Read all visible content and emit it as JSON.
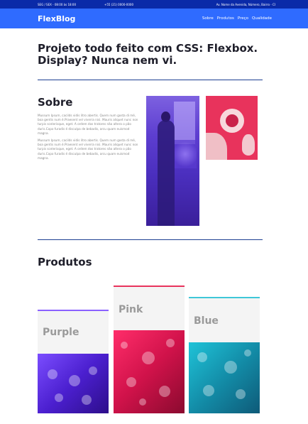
{
  "topbar": {
    "schedule": "SEG / SEX - 08:00 às 18:00",
    "phone": "+55 (21) 0000-0000",
    "address": "Av. Nome da Avenida, Número, Bairro - CI"
  },
  "header": {
    "logo": "FlexBlog",
    "nav": [
      "Sobre",
      "Produtos",
      "Preço",
      "Qualidade"
    ]
  },
  "intro": {
    "title_line1": "Projeto todo feito com CSS: Flexbox.",
    "title_line2": "Display? Nunca nem vi."
  },
  "sobre": {
    "title": "Sobre",
    "paragraphs": [
      "Mussum Ipsum, cacilds vidis litro abertis. Quem num gosta di mé, boa gentis num é.Praesent vel viverra nisi. Mauris aliquet nunc non turpis scelerisque, eget. A ordem dos tratores não altera o pão duris.Copo furadis é disculpa de bebadis, arcu quam euismod magna.",
      "Mussum Ipsum, cacilds vidis litro abertis. Quem num gosta di mé, boa gentis num é.Praesent vel viverra nisi. Mauris aliquet nunc non turpis scelerisque, eget. A ordem dos tratores não altera o pão duris.Copo furadis é disculpa de bebadis, arcu quam euismod magna."
    ]
  },
  "produtos": {
    "title": "Produtos",
    "cards": [
      {
        "label": "Purple",
        "accent": "#8a60ff"
      },
      {
        "label": "Pink",
        "accent": "#e8335c"
      },
      {
        "label": "Blue",
        "accent": "#3fc7d8"
      }
    ]
  },
  "colors": {
    "topbar_bg": "#0a2aa8",
    "header_bg": "#2f6bff",
    "divider": "#1d3f91"
  }
}
